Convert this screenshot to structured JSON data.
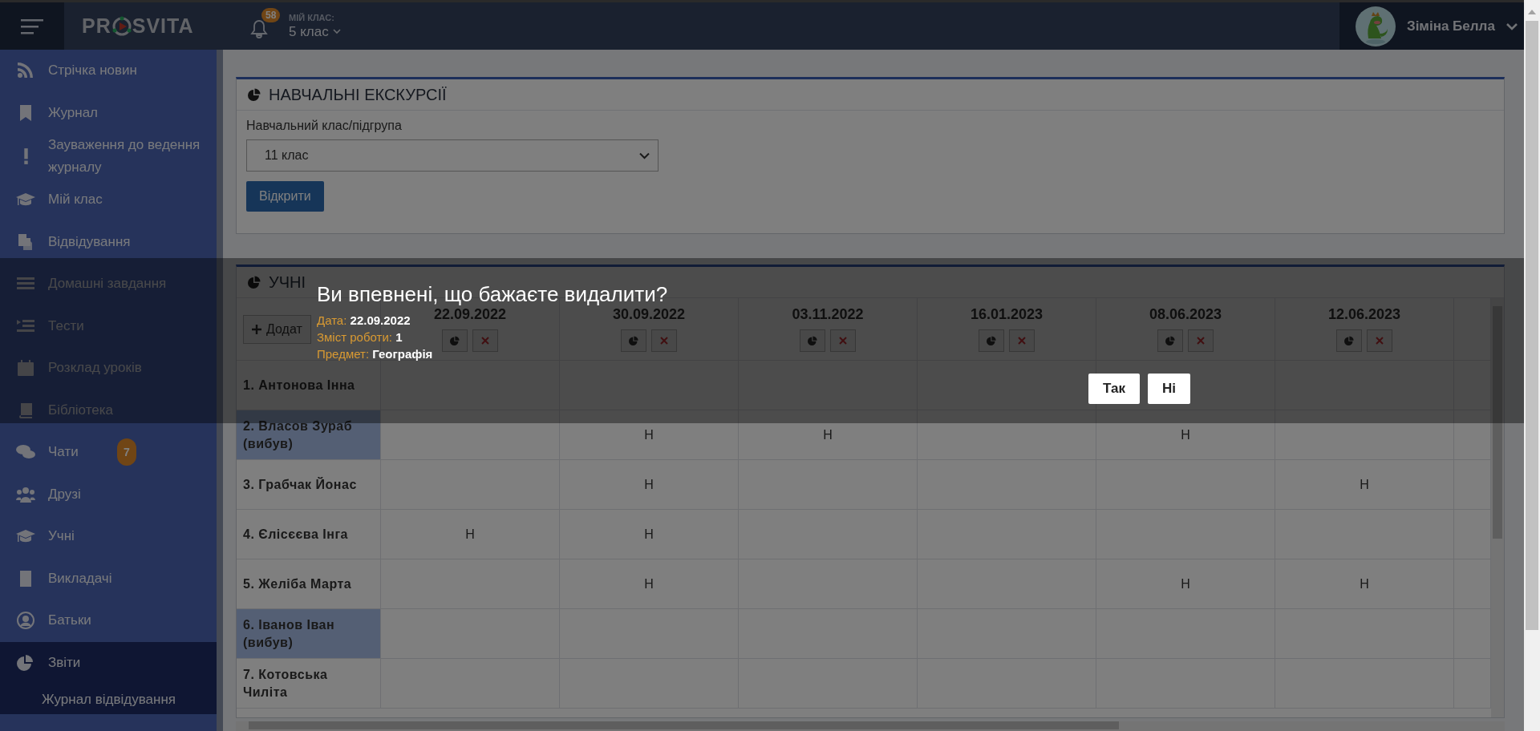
{
  "header": {
    "logo_left": "PR",
    "logo_right": "SVITA",
    "notifications": "58",
    "class_label": "МІЙ КЛАС:",
    "class_value": "5 клас",
    "user_name": "Зіміна Белла"
  },
  "sidebar": {
    "items": [
      {
        "label": "Стрічка новин",
        "selected": false
      },
      {
        "label": "Журнал",
        "selected": false
      },
      {
        "label": "Зауваження до ведення журналу",
        "selected": false
      },
      {
        "label": "Мій клас",
        "selected": false
      },
      {
        "label": "Відвідування",
        "selected": false
      },
      {
        "label": "Домашні завдання",
        "selected": false
      },
      {
        "label": "Тести",
        "selected": false
      },
      {
        "label": "Розклад уроків",
        "selected": false
      },
      {
        "label": "Бібліотека",
        "selected": false
      },
      {
        "label": "Чати",
        "badge": "7",
        "selected": false
      },
      {
        "label": "Друзі",
        "selected": false
      },
      {
        "label": "Учні",
        "selected": false
      },
      {
        "label": "Викладачі",
        "selected": false
      },
      {
        "label": "Батьки",
        "selected": false
      },
      {
        "label": "Звіти",
        "selected": true,
        "expanded": true,
        "children": [
          {
            "label": "Журнал відвідування",
            "selected": false
          }
        ]
      }
    ]
  },
  "excursions": {
    "title": "НАВЧАЛЬНІ ЕКСКУРСІЇ",
    "field_label": "Навчальний клас/підгрупа",
    "select_value": "11 клас",
    "open_button": "Відкрити"
  },
  "students": {
    "title": "УЧНІ",
    "add_button": "Додат",
    "dates": [
      "22.09.2022",
      "30.09.2022",
      "03.11.2022",
      "16.01.2023",
      "08.06.2023",
      "12.06.2023"
    ],
    "rows": [
      {
        "name": "1. Антонова Інна",
        "dropped": false,
        "cells": [
          {},
          {},
          {},
          {},
          {},
          {}
        ]
      },
      {
        "name": "2. Власов Зураб (вибув)",
        "dropped": true,
        "cells": [
          {},
          {
            "mark": "Н"
          },
          {
            "mark": "Н"
          },
          {},
          {
            "mark": "Н"
          },
          {}
        ]
      },
      {
        "name": "3. Грабчак Йонас",
        "dropped": false,
        "cells": [
          {},
          {
            "mark": "Н"
          },
          {},
          {},
          {},
          {
            "mark": "Н"
          }
        ]
      },
      {
        "name": "4. Єлісєєва Інга",
        "dropped": false,
        "cells": [
          {
            "mark": "Н"
          },
          {
            "mark": "Н"
          },
          {},
          {},
          {},
          {}
        ]
      },
      {
        "name": "5. Желіба Марта",
        "dropped": false,
        "cells": [
          {},
          {
            "mark": "Н"
          },
          {},
          {},
          {
            "mark": "Н"
          },
          {
            "mark": "Н"
          }
        ]
      },
      {
        "name": "6. Іванов Іван (вибув)",
        "dropped": true,
        "cells": [
          {},
          {},
          {},
          {},
          {},
          {}
        ]
      },
      {
        "name": "7. Котовська Чиліта",
        "dropped": false,
        "cells": [
          {},
          {},
          {},
          {},
          {},
          {}
        ]
      }
    ]
  },
  "dialog": {
    "title": "Ви впевнені, що бажаєте видалити?",
    "fields": [
      {
        "label": "Дата:",
        "value": "22.09.2022"
      },
      {
        "label": "Зміст роботи:",
        "value": "1"
      },
      {
        "label": "Предмет:",
        "value": "Географія"
      }
    ],
    "buttons": [
      "Так",
      "Ні"
    ]
  }
}
